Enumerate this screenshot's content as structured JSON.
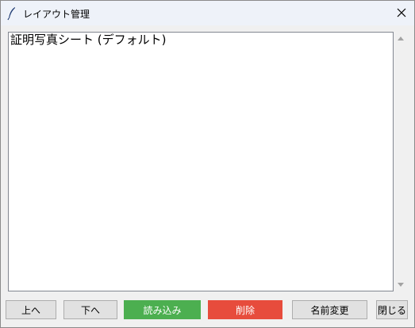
{
  "window": {
    "title": "レイアウト管理",
    "title_icon": "feather-icon",
    "close_icon": "close-icon"
  },
  "list": {
    "items": [
      "証明写真シート (デフォルト)"
    ],
    "selected_index": 0
  },
  "buttons": {
    "up": "上へ",
    "down": "下へ",
    "load": "読み込み",
    "delete": "削除",
    "rename": "名前変更",
    "close": "閉じる"
  },
  "colors": {
    "load_button": "#4caf50",
    "delete_button": "#e74c3c"
  }
}
